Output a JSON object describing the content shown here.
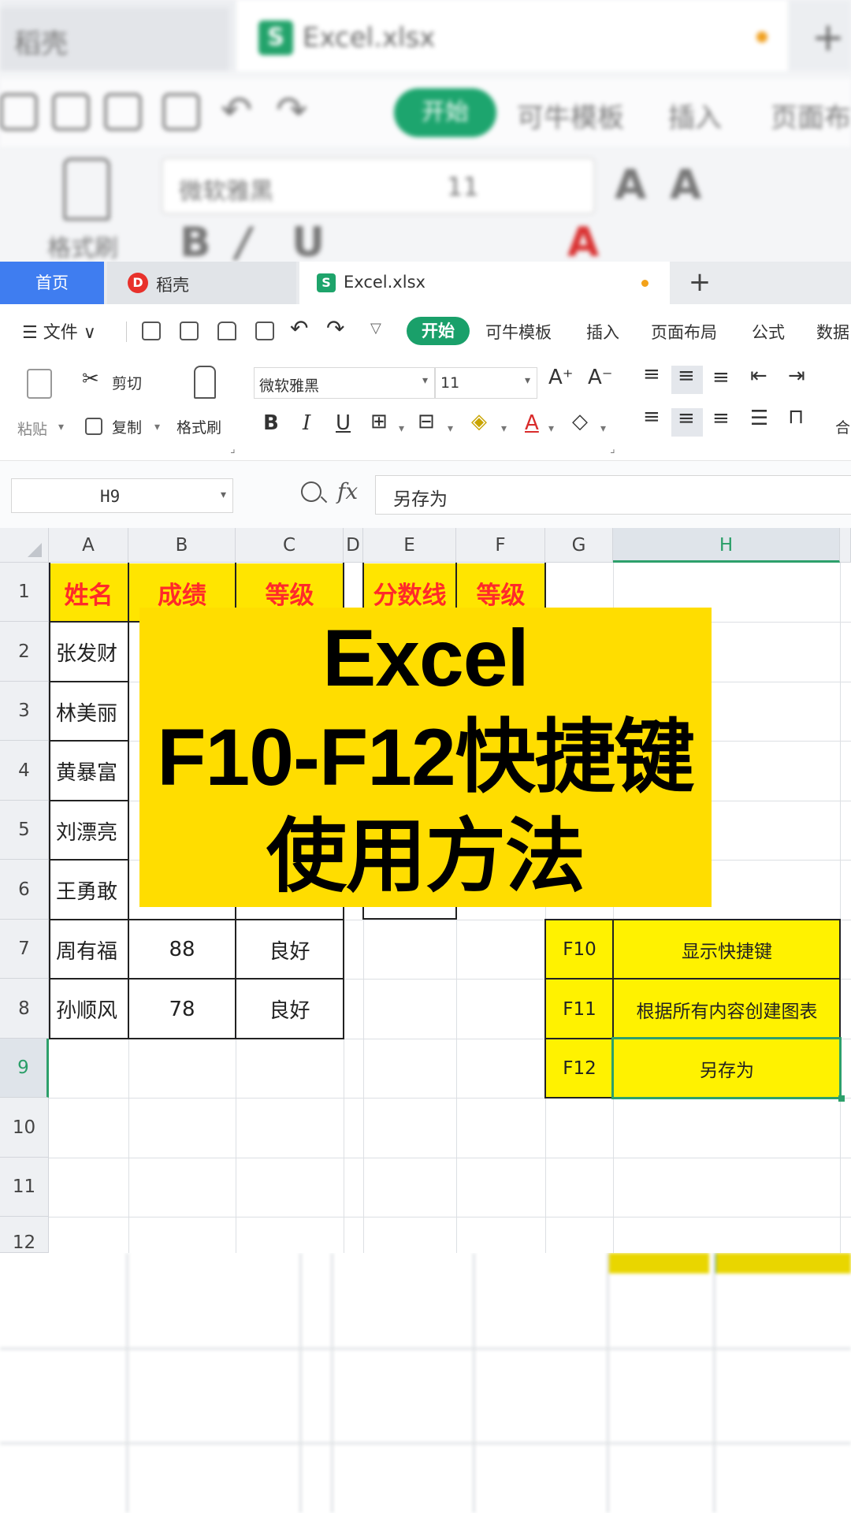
{
  "tabs": {
    "home": "首页",
    "daoke": "稻壳",
    "excel": "Excel.xlsx",
    "new_tab": "+"
  },
  "menu": {
    "file": "☰ 文件 ∨",
    "start": "开始",
    "items": [
      "可牛模板",
      "插入",
      "页面布局",
      "公式",
      "数据"
    ]
  },
  "ribbon": {
    "paste": "粘贴",
    "cut": "剪切",
    "copy": "复制",
    "format_painter": "格式刷",
    "font_name": "微软雅黑",
    "font_size": "11",
    "bold": "B",
    "italic": "I",
    "underline": "U",
    "grow_font": "A⁺",
    "shrink_font": "A⁻",
    "merge_partial": "合"
  },
  "formula_bar": {
    "cell_ref": "H9",
    "fx": "fx",
    "content": "另存为"
  },
  "sheet": {
    "columns": [
      "A",
      "B",
      "C",
      "D",
      "E",
      "F",
      "G",
      "H"
    ],
    "rows": [
      "1",
      "2",
      "3",
      "4",
      "5",
      "6",
      "7",
      "8",
      "9",
      "10",
      "11",
      "12"
    ],
    "header_row": [
      "姓名",
      "成绩",
      "等级",
      "分数线",
      "等级"
    ],
    "names": [
      "张发财",
      "林美丽",
      "黄暴富",
      "刘漂亮",
      "王勇敢",
      "周有福",
      "孙顺风"
    ],
    "row7": {
      "score": "88",
      "grade": "良好"
    },
    "row8": {
      "score": "78",
      "grade": "良好"
    },
    "shortcuts": [
      {
        "key": "F10",
        "desc": "显示快捷键"
      },
      {
        "key": "F11",
        "desc": "根据所有内容创建图表"
      },
      {
        "key": "F12",
        "desc": "另存为"
      }
    ]
  },
  "overlay": {
    "line1": "Excel",
    "line2": "F10-F12快捷键",
    "line3": "使用方法"
  },
  "background": {
    "tab_left": "稻壳",
    "tab_right": "Excel.xlsx",
    "start": "开始",
    "menu1": "可牛模板",
    "menu2": "插入",
    "menu3": "页面布",
    "font": "微软雅黑",
    "size": "11",
    "format_painter": "格式刷"
  },
  "colors": {
    "accent_green": "#1aa06a",
    "header_yellow": "#ffe500",
    "header_red": "#ff2a2a",
    "overlay_yellow": "#ffdd00",
    "tab_blue": "#3f7df0"
  }
}
